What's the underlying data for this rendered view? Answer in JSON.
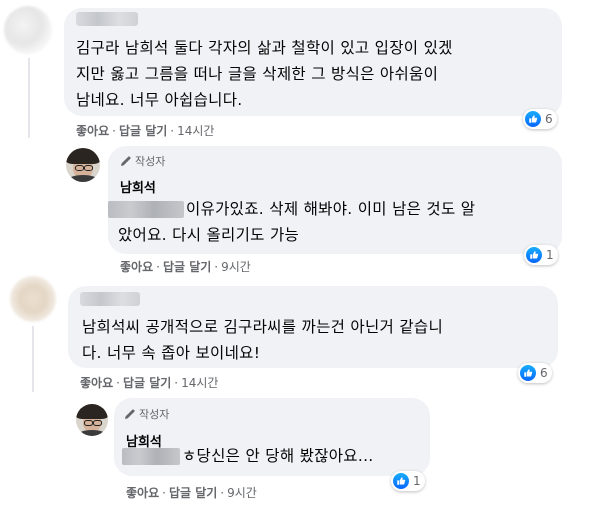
{
  "comments": [
    {
      "text_lines": [
        "김구라 남희석 둘다 각자의 삶과 철학이 있고 입장이 있겠",
        "지만 옳고 그름을 떠나 글을 삭제한 그 방식은 아쉬움이",
        "남네요. 너무 아쉽습니다."
      ],
      "actions": {
        "like": "좋아요",
        "reply": "답글 달기",
        "time": "14시간"
      },
      "reaction_count": "6",
      "reply": {
        "badge": "작성자",
        "name": "남희석",
        "text_lines": [
          "이유가있죠. 삭제 해봐야. 이미 남은 것도 알",
          "았어요. 다시 올리기도 가능"
        ],
        "actions": {
          "like": "좋아요",
          "reply": "답글 달기",
          "time": "9시간"
        },
        "reaction_count": "1"
      }
    },
    {
      "text_lines": [
        "남희석씨 공개적으로 김구라씨를 까는건 아닌거 같습니",
        "다. 너무 속 좁아 보이네요!"
      ],
      "actions": {
        "like": "좋아요",
        "reply": "답글 달기",
        "time": "14시간"
      },
      "reaction_count": "6",
      "reply": {
        "badge": "작성자",
        "name": "남희석",
        "text_lines": [
          "ㅎ당신은 안 당해 봤잖아요..."
        ],
        "actions": {
          "like": "좋아요",
          "reply": "답글 달기",
          "time": "9시간"
        },
        "reaction_count": "1"
      }
    }
  ],
  "separator": "·",
  "colors": {
    "bubble": "#f0f2f5",
    "meta": "#65676b",
    "like_blue": "#0866ff"
  },
  "icons": {
    "badge": "pencil-icon",
    "reaction": "like-thumb-icon"
  }
}
